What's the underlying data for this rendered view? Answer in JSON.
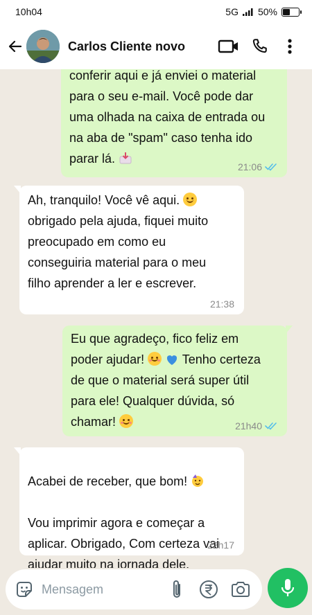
{
  "status_bar": {
    "time": "10h04",
    "network": "5G",
    "battery": "50%",
    "battery_level": 0.5
  },
  "header": {
    "contact_name": "Carlos Cliente novo",
    "icons": [
      "back-arrow-icon",
      "video-call-icon",
      "phone-icon",
      "more-options-icon"
    ]
  },
  "messages": [
    {
      "direction": "out",
      "text": "conferir aqui e já enviei o material\npara o seu e-mail. Você pode dar\numa olhada na caixa de entrada ou\nna aba de \"spam\" caso tenha ido\nparar lá.",
      "time": "21:06",
      "read": true
    },
    {
      "direction": "in",
      "text_before": " Ah, tranquilo! Você vê aqui. ",
      "text_after": "\nobrigado pela ajuda, fiquei muito\npreocupado em como eu\nconseguiria material para o meu\nfilho aprender a ler e escrever.",
      "time": "21:38"
    },
    {
      "direction": "out",
      "line1": " Eu que agradeço, fico feliz em",
      "line2_a": "poder ajudar! ",
      "line2_b": " Tenho certeza",
      "line3": "de que o material será super útil",
      "line4": "para ele! Qualquer dúvida, só",
      "line5": "chamar! ",
      "time": "21h40",
      "read": true
    },
    {
      "direction": "in",
      "line1": " Acabei de receber, que bom! ",
      "rest": "Vou imprimir agora e começar a\naplicar. Obrigado, Com certeza vai\najudar muito na jornada dele.",
      "time": "22h17"
    }
  ],
  "input": {
    "placeholder": "Mensagem"
  },
  "colors": {
    "chat_background": "#efeae2",
    "outgoing_bubble": "#dcf8c6",
    "incoming_bubble": "#ffffff",
    "read_ticks": "#53bdeb",
    "mic_button": "#21c063"
  }
}
